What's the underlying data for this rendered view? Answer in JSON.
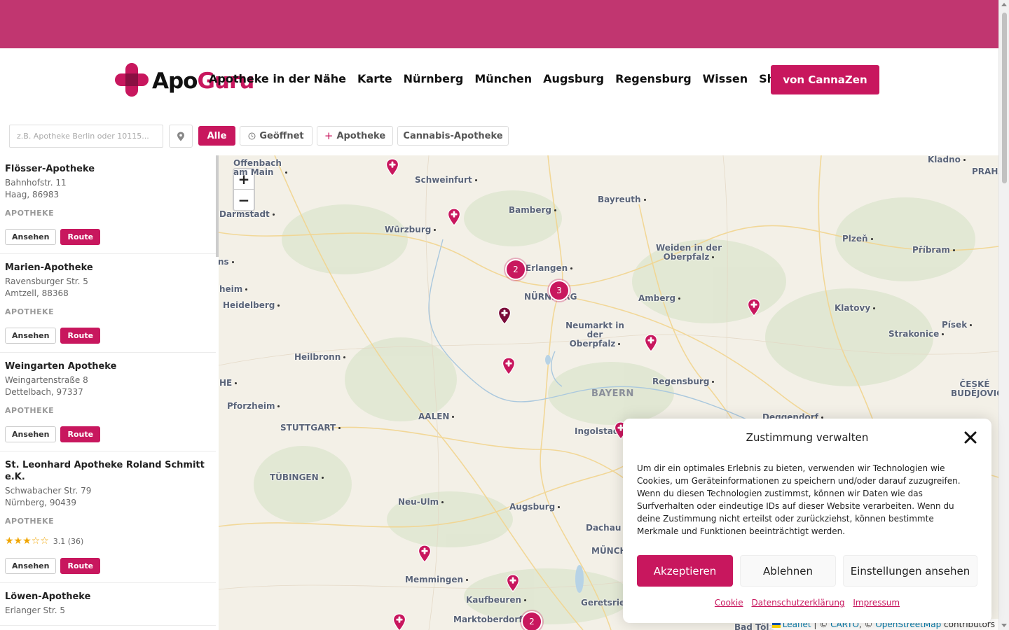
{
  "brand": {
    "name_part1": "Apo",
    "name_part2": "Guru",
    "accent": "#c8175e",
    "topbar": "#c13670"
  },
  "nav": {
    "items": [
      "Apotheke in der Nähe",
      "Karte",
      "Nürnberg",
      "München",
      "Augsburg",
      "Regensburg",
      "Wissen",
      "Shop"
    ],
    "cta": "von CannaZen"
  },
  "filters": {
    "search_placeholder": "z.B. Apotheke Berlin oder 10115...",
    "chips": [
      "Alle",
      "Geöffnet",
      "Apotheke",
      "Cannabis-Apotheke"
    ],
    "active": "Alle"
  },
  "list": {
    "view_label": "Ansehen",
    "route_label": "Route",
    "items": [
      {
        "name": "Flösser-Apotheke",
        "street": "Bahnhofstr. 11",
        "city": "Haag, 86983",
        "type": "APOTHEKE"
      },
      {
        "name": "Marien-Apotheke",
        "street": "Ravensburger Str. 5",
        "city": "Amtzell, 88368",
        "type": "APOTHEKE"
      },
      {
        "name": "Weingarten Apotheke",
        "street": "Weingartenstraße 8",
        "city": "Dettelbach, 97337",
        "type": "APOTHEKE"
      },
      {
        "name": "St. Leonhard Apotheke Roland Schmitt e.K.",
        "street": "Schwabacher Str. 79",
        "city": "Nürnberg, 90439",
        "type": "APOTHEKE",
        "stars": "★★★☆☆",
        "rating": "3.1 (36)"
      },
      {
        "name": "Löwen-Apotheke",
        "street": "Erlanger Str. 5",
        "city": "",
        "type": ""
      }
    ]
  },
  "map": {
    "zoom_in": "+",
    "zoom_out": "−",
    "cities": [
      "Offenbach am Main",
      "Schweinfurt",
      "Bamberg",
      "Bayreuth",
      "Kladno",
      "PRAHA",
      "Darmstadt",
      "Würzburg",
      "Erlangen",
      "Weiden in der Oberpfalz",
      "Plzeň",
      "Příbram",
      "Heidelberg",
      "NÜRNBERG",
      "Amberg",
      "Klatovy",
      "Neumarkt in der Oberpfalz",
      "Strakonice",
      "Písek",
      "Heilbronn",
      "Regensburg",
      "ČESKÉ BUDĚJOVICE",
      "Pforzheim",
      "AALEN",
      "STUTTGART",
      "Ingolstadt",
      "Deggendorf",
      "TÜBINGEN",
      "Neu-Ulm",
      "Augsburg",
      "Dachau",
      "MÜNCHEN",
      "Memmingen",
      "Kaufbeuren",
      "Geretsried",
      "Marktoberdorf",
      "Bad Tölz",
      "ns",
      "heim",
      "HE"
    ],
    "region": "BAYERN",
    "clusters": [
      "2",
      "3",
      "2"
    ],
    "attribution": {
      "leaflet": "Leaflet",
      "sep": " | © ",
      "carto": "CARTO",
      "sep2": ", © ",
      "osm": "OpenStreetMap",
      "tail": " contributors"
    }
  },
  "consent": {
    "title": "Zustimmung verwalten",
    "text": "Um dir ein optimales Erlebnis zu bieten, verwenden wir Technologien wie Cookies, um Geräteinformationen zu speichern und/oder darauf zuzugreifen. Wenn du diesen Technologien zustimmst, können wir Daten wie das Surfverhalten oder eindeutige IDs auf dieser Website verarbeiten. Wenn du deine Zustimmung nicht erteilst oder zurückziehst, können bestimmte Merkmale und Funktionen beeinträchtigt werden.",
    "accept": "Akzeptieren",
    "deny": "Ablehnen",
    "prefs": "Einstellungen ansehen",
    "links": [
      "Cookie",
      "Datenschutzerklärung",
      "Impressum"
    ]
  }
}
